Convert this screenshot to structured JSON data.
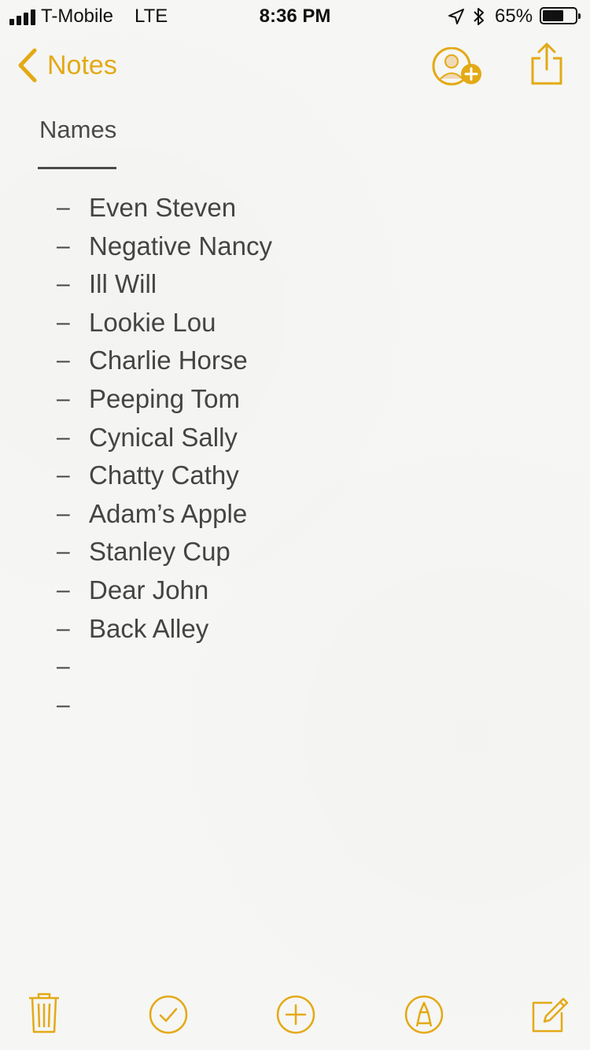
{
  "status_bar": {
    "carrier": "T-Mobile",
    "network": "LTE",
    "time": "8:36 PM",
    "battery_percent": "65%",
    "battery_level": 0.65
  },
  "nav": {
    "back_label": "Notes",
    "back_icon": "chevron-left-icon",
    "add_person_icon": "add-person-icon",
    "share_icon": "share-icon"
  },
  "note": {
    "title": "Names",
    "items": [
      "Even Steven",
      "Negative Nancy",
      "Ill Will",
      "Lookie Lou",
      "Charlie Horse",
      "Peeping Tom",
      "Cynical Sally",
      "Chatty Cathy",
      "Adam’s Apple",
      "Stanley Cup",
      "Dear John",
      "Back Alley",
      "",
      ""
    ],
    "dash": "–"
  },
  "toolbar": {
    "delete_icon": "trash-icon",
    "checklist_icon": "checkmark-circle-icon",
    "add_icon": "plus-circle-icon",
    "markup_icon": "pen-circle-icon",
    "compose_icon": "compose-icon"
  },
  "colors": {
    "accent": "#e3aa16",
    "text": "#4a4a4a",
    "background": "#f6f6f4"
  }
}
